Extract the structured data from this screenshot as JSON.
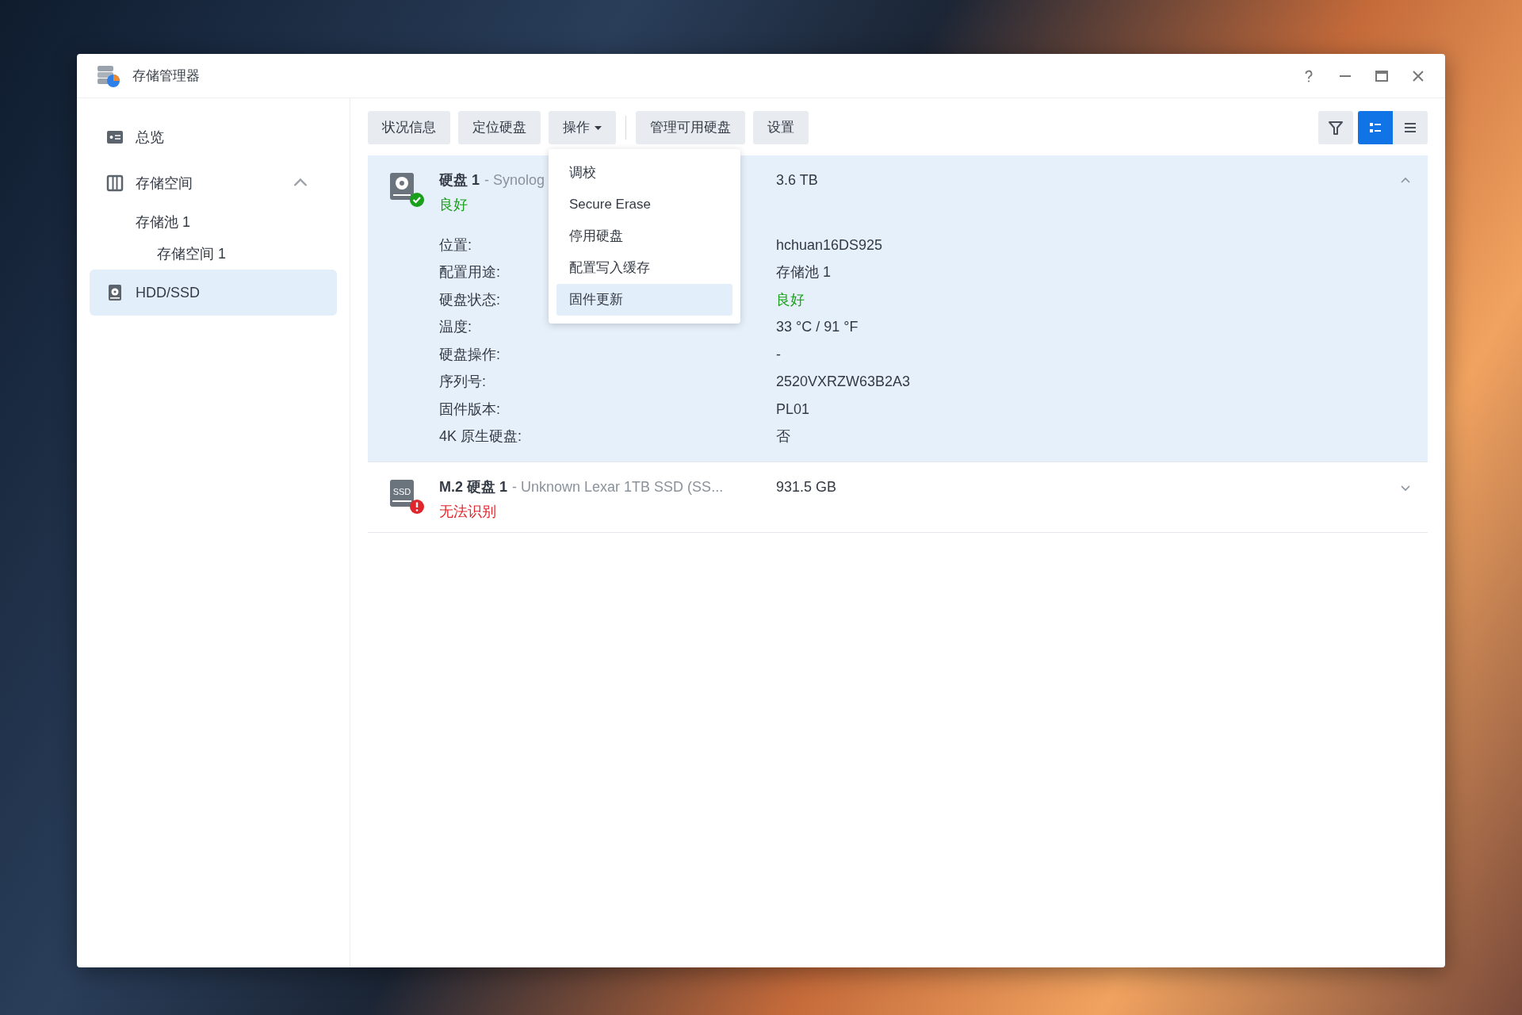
{
  "window": {
    "title": "存储管理器"
  },
  "sidebar": {
    "items": [
      {
        "label": "总览",
        "kind": "overview",
        "selected": false
      },
      {
        "label": "存储空间",
        "kind": "storage",
        "selected": false,
        "expanded": true,
        "children": [
          {
            "label": "存储池 1",
            "selected": false,
            "children": [
              {
                "label": "存储空间 1",
                "selected": false
              }
            ]
          }
        ]
      },
      {
        "label": "HDD/SSD",
        "kind": "disk",
        "selected": true
      }
    ]
  },
  "toolbar": {
    "buttons": [
      {
        "label": "状况信息"
      },
      {
        "label": "定位硬盘"
      },
      {
        "label": "操作",
        "kind": "dropdown"
      },
      {
        "label": "管理可用硬盘"
      },
      {
        "label": "设置"
      }
    ],
    "view_modes": [
      {
        "kind": "detail",
        "selected": true
      },
      {
        "kind": "list",
        "selected": false
      }
    ]
  },
  "menu": {
    "items": [
      {
        "label": "调校",
        "selected": false
      },
      {
        "label": "Secure Erase",
        "selected": false
      },
      {
        "label": "停用硬盘",
        "selected": false
      },
      {
        "label": "配置写入缓存",
        "selected": false
      },
      {
        "label": "固件更新",
        "selected": true
      }
    ]
  },
  "disks": [
    {
      "kind": "hdd",
      "name": "硬盘 1",
      "model": "- Synolog",
      "status": "良好",
      "healthy": true,
      "capacity": "3.6 TB",
      "expanded": true,
      "details": [
        {
          "label": "位置:",
          "value": "hchuan16DS925",
          "kind": "plain"
        },
        {
          "label": "配置用途:",
          "value": "存储池 1",
          "kind": "plain"
        },
        {
          "label": "硬盘状态:",
          "value": "良好",
          "kind": "ok"
        },
        {
          "label": "温度:",
          "value": "33 °C / 91 °F",
          "kind": "plain"
        },
        {
          "label": "硬盘操作:",
          "value": "-",
          "kind": "plain"
        },
        {
          "label": "序列号:",
          "value": "2520VXRZW63B2A3",
          "kind": "plain"
        },
        {
          "label": "固件版本:",
          "value": "PL01",
          "kind": "plain"
        },
        {
          "label": "4K 原生硬盘:",
          "value": "否",
          "kind": "plain"
        }
      ]
    },
    {
      "kind": "ssd",
      "icon_label": "SSD",
      "name": "M.2 硬盘 1",
      "model": "- Unknown Lexar 1TB SSD (SS...",
      "status": "无法识别",
      "healthy": false,
      "capacity": "931.5 GB",
      "expanded": false
    }
  ]
}
